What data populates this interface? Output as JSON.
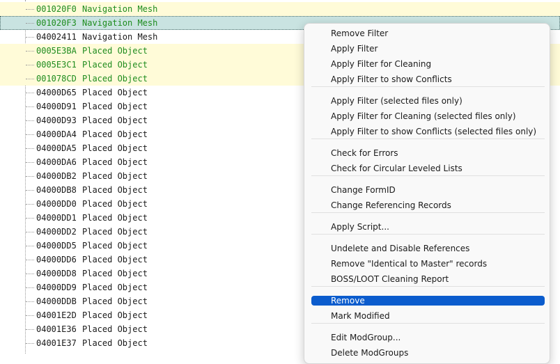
{
  "tree": {
    "rows": [
      {
        "formid": "001020F0",
        "type": "Navigation Mesh",
        "style": "green yellow"
      },
      {
        "formid": "001020F3",
        "type": "Navigation Mesh",
        "style": "green selected"
      },
      {
        "formid": "04002411",
        "type": "Navigation Mesh",
        "style": "black"
      },
      {
        "formid": "0005E3BA",
        "type": "Placed Object",
        "style": "green yellow"
      },
      {
        "formid": "0005E3C1",
        "type": "Placed Object",
        "style": "green yellow"
      },
      {
        "formid": "001078CD",
        "type": "Placed Object",
        "style": "green yellow"
      },
      {
        "formid": "04000D65",
        "type": "Placed Object",
        "style": "black"
      },
      {
        "formid": "04000D91",
        "type": "Placed Object",
        "style": "black"
      },
      {
        "formid": "04000D93",
        "type": "Placed Object",
        "style": "black"
      },
      {
        "formid": "04000DA4",
        "type": "Placed Object",
        "style": "black"
      },
      {
        "formid": "04000DA5",
        "type": "Placed Object",
        "style": "black"
      },
      {
        "formid": "04000DA6",
        "type": "Placed Object",
        "style": "black"
      },
      {
        "formid": "04000DB2",
        "type": "Placed Object",
        "style": "black"
      },
      {
        "formid": "04000DB8",
        "type": "Placed Object",
        "style": "black"
      },
      {
        "formid": "04000DD0",
        "type": "Placed Object",
        "style": "black"
      },
      {
        "formid": "04000DD1",
        "type": "Placed Object",
        "style": "black"
      },
      {
        "formid": "04000DD2",
        "type": "Placed Object",
        "style": "black"
      },
      {
        "formid": "04000DD5",
        "type": "Placed Object",
        "style": "black"
      },
      {
        "formid": "04000DD6",
        "type": "Placed Object",
        "style": "black"
      },
      {
        "formid": "04000DD8",
        "type": "Placed Object",
        "style": "black"
      },
      {
        "formid": "04000DD9",
        "type": "Placed Object",
        "style": "black"
      },
      {
        "formid": "04000DDB",
        "type": "Placed Object",
        "style": "black"
      },
      {
        "formid": "04001E2D",
        "type": "Placed Object",
        "style": "black"
      },
      {
        "formid": "04001E36",
        "type": "Placed Object",
        "style": "black"
      },
      {
        "formid": "04001E37",
        "type": "Placed Object",
        "style": "black"
      }
    ]
  },
  "context_menu": {
    "items": [
      {
        "label": "Remove Filter"
      },
      {
        "label": "Apply Filter"
      },
      {
        "label": "Apply Filter for Cleaning"
      },
      {
        "label": "Apply Filter to show Conflicts"
      },
      {
        "label": "Apply Filter (selected files only)"
      },
      {
        "label": "Apply Filter for Cleaning (selected files only)"
      },
      {
        "label": "Apply Filter to show Conflicts (selected files only)"
      },
      {
        "label": "Check for Errors"
      },
      {
        "label": "Check for Circular Leveled Lists"
      },
      {
        "label": "Change FormID"
      },
      {
        "label": "Change Referencing Records"
      },
      {
        "label": "Apply Script..."
      },
      {
        "label": "Undelete and Disable References"
      },
      {
        "label": "Remove \"Identical to Master\" records"
      },
      {
        "label": "BOSS/LOOT Cleaning Report"
      },
      {
        "label": "Remove",
        "highlighted": true
      },
      {
        "label": "Mark Modified"
      },
      {
        "label": "Edit ModGroup..."
      },
      {
        "label": "Delete ModGroups"
      }
    ]
  },
  "colors": {
    "highlight": "#0b5ccd",
    "master_text": "#1e8c1e",
    "override_bg": "#fffbd8",
    "selected_bg": "#c9e3e1"
  }
}
